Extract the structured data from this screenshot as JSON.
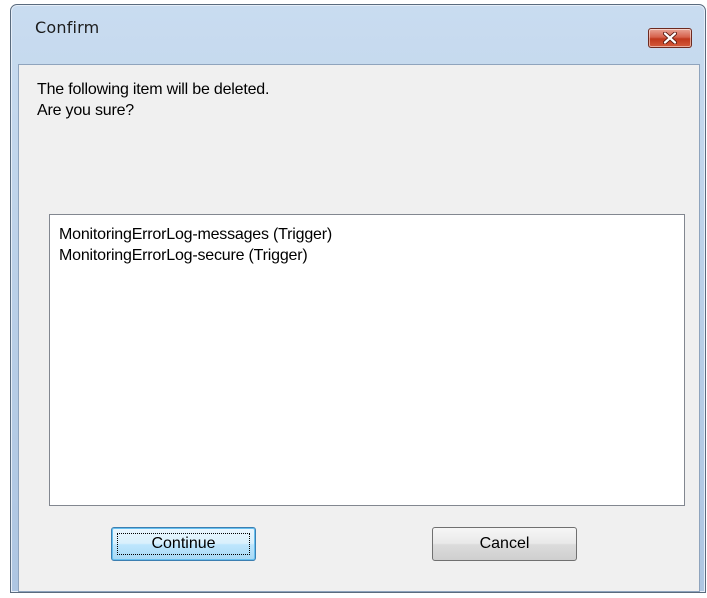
{
  "dialog": {
    "title": "Confirm",
    "message_line1": "The following item will be deleted.",
    "message_line2": "Are you sure?",
    "items": [
      "MonitoringErrorLog-messages (Trigger)",
      "MonitoringErrorLog-secure (Trigger)"
    ],
    "continue_label": "Continue",
    "cancel_label": "Cancel",
    "close_icon": "close-icon"
  },
  "colors": {
    "close_button": "#c7432a",
    "window_frame": "#b9cfe7",
    "client_bg": "#f0f0f0"
  }
}
